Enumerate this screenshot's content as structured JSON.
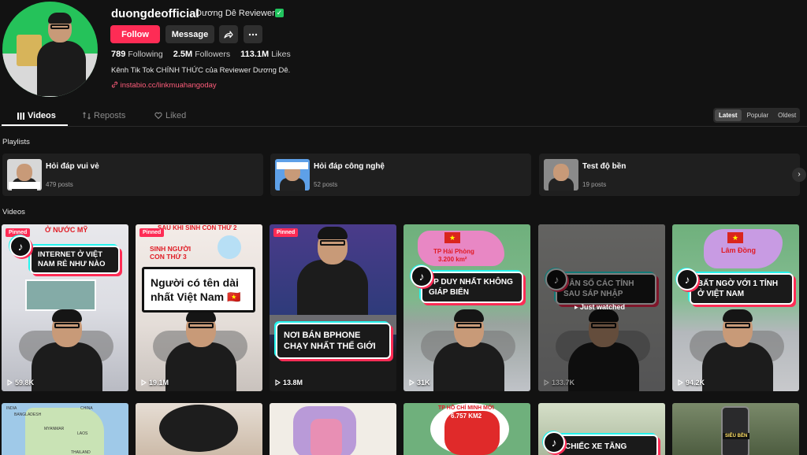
{
  "profile": {
    "username": "duongdeofficial",
    "nickname": "Dương Dê Reviewer",
    "verified_mark": "✓",
    "follow_label": "Follow",
    "message_label": "Message",
    "following_count": "789",
    "following_label": "Following",
    "followers_count": "2.5M",
    "followers_label": "Followers",
    "likes_count": "113.1M",
    "likes_label": "Likes",
    "bio": "Kênh Tik Tok CHÍNH THỨC của Reviewer Dương Dê.",
    "link": "instabio.cc/linkmuahangoday"
  },
  "tabs": [
    {
      "label": "Videos",
      "icon": "grid-icon"
    },
    {
      "label": "Reposts",
      "icon": "repost-icon"
    },
    {
      "label": "Liked",
      "icon": "heart-icon"
    }
  ],
  "sort": [
    "Latest",
    "Popular",
    "Oldest"
  ],
  "sections": {
    "playlists": "Playlists",
    "videos": "Videos"
  },
  "playlists": [
    {
      "name": "Hỏi đáp vui vẻ",
      "count": "479 posts"
    },
    {
      "name": "Hỏi đáp công nghệ",
      "count": "52 posts"
    },
    {
      "name": "Test độ bền",
      "count": "19 posts"
    }
  ],
  "videos": [
    {
      "pinned": "Pinned",
      "top_text": "Ở NƯỚC MỸ",
      "title": "INTERNET Ở VIỆT NAM RẺ NHƯ NÀO",
      "views": "59.8K"
    },
    {
      "pinned": "Pinned",
      "top_text": "SAU KHI SINH CON THỨ 2",
      "sub_text": "SINH NGƯỜI CON THỨ 3",
      "title": "Người có tên dài nhất Việt Nam 🇻🇳",
      "views": "19.1M"
    },
    {
      "pinned": "Pinned",
      "title": "NƠI BÁN BPHONE CHẠY NHẤT THẾ GIỚI",
      "views": "13.8M"
    },
    {
      "top_text": "TP Hải Phòng",
      "sub_text": "3.200 km²",
      "title": "TP DUY NHẤT KHÔNG GIÁP BIỂN",
      "views": "31K"
    },
    {
      "title": "DÂN SỐ CÁC TỈNH SAU SÁP NHẬP",
      "watched": "Just watched",
      "views": "133.7K"
    },
    {
      "top_text": "Lâm Đồng",
      "title": "BẤT NGỜ VỚI 1 TỈNH Ở VIỆT NAM",
      "views": "94.2K"
    }
  ],
  "videos_row2": [
    {
      "labels": [
        "BANGLADESH",
        "MYANMAR",
        "LAOS",
        "THAILAND",
        "INDIA",
        "CHINA"
      ]
    },
    {},
    {},
    {
      "top_text": "TP HỒ CHÍ MINH MỚI",
      "sub_text": "6.757 KM2"
    },
    {
      "title": "CHIẾC XE TĂNG"
    },
    {
      "badge": "SIÊU BỀN"
    }
  ]
}
